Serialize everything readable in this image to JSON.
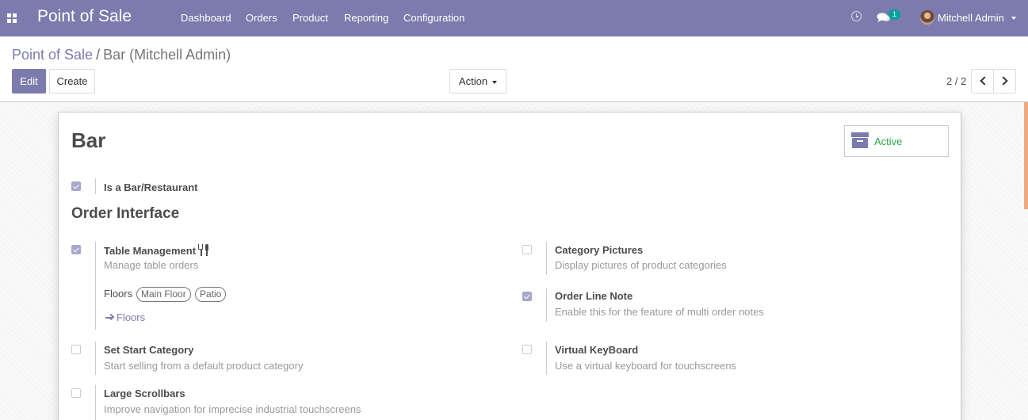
{
  "navbar": {
    "app_title": "Point of Sale",
    "menu": [
      "Dashboard",
      "Orders",
      "Product",
      "Reporting",
      "Configuration"
    ],
    "message_count": "1",
    "user_name": "Mitchell Admin"
  },
  "breadcrumb": {
    "parent": "Point of Sale",
    "separator": "/",
    "current": "Bar (Mitchell Admin)"
  },
  "toolbar": {
    "edit_label": "Edit",
    "create_label": "Create",
    "action_label": "Action",
    "pager": "2 / 2"
  },
  "record": {
    "name": "Bar",
    "active_label": "Active",
    "is_bar_restaurant": {
      "label": "Is a Bar/Restaurant",
      "checked": true
    },
    "section_title": "Order Interface",
    "settings": {
      "table_management": {
        "label": "Table Management",
        "desc": "Manage table orders",
        "checked": true
      },
      "category_pictures": {
        "label": "Category Pictures",
        "desc": "Display pictures of product categories",
        "checked": false
      },
      "order_line_note": {
        "label": "Order Line Note",
        "desc": "Enable this for the feature of multi order notes",
        "checked": true
      },
      "set_start_category": {
        "label": "Set Start Category",
        "desc": "Start selling from a default product category",
        "checked": false
      },
      "virtual_keyboard": {
        "label": "Virtual KeyBoard",
        "desc": "Use a virtual keyboard for touchscreens",
        "checked": false
      },
      "large_scrollbars": {
        "label": "Large Scrollbars",
        "desc": "Improve navigation for imprecise industrial touchscreens",
        "checked": false
      }
    },
    "floors": {
      "label": "Floors",
      "tags": [
        "Main Floor",
        "Patio"
      ],
      "link_label": "Floors"
    }
  },
  "colors": {
    "brand": "#7c7bad",
    "active": "#28a745",
    "badge": "#00a09d"
  }
}
